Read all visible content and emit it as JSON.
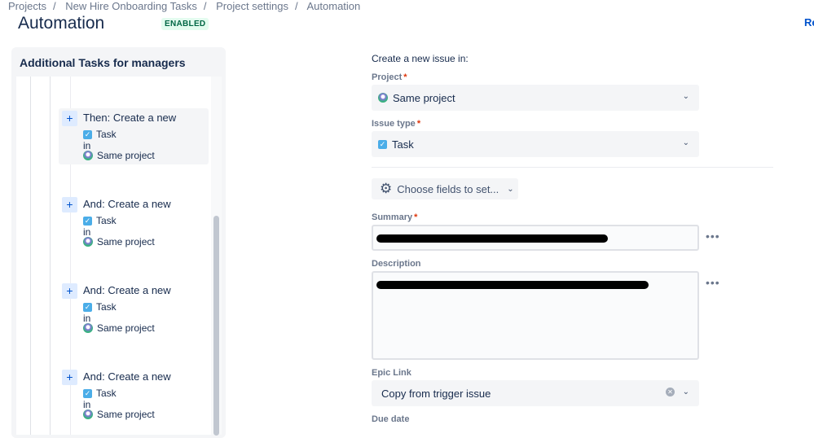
{
  "breadcrumbs": [
    "Projects",
    "New Hire Onboarding Tasks",
    "Project settings",
    "Automation"
  ],
  "header": {
    "title": "Automation",
    "status": "ENABLED",
    "right_link": "Re"
  },
  "rule": {
    "name": "Additional Tasks for managers",
    "steps": [
      {
        "heading": "Then: Create a new",
        "issue_type": "Task",
        "in": "in",
        "project": "Same project"
      },
      {
        "heading": "And: Create a new",
        "issue_type": "Task",
        "in": "in",
        "project": "Same project"
      },
      {
        "heading": "And: Create a new",
        "issue_type": "Task",
        "in": "in",
        "project": "Same project"
      },
      {
        "heading": "And: Create a new",
        "issue_type": "Task",
        "in": "in",
        "project": "Same project"
      }
    ]
  },
  "form": {
    "intro": "Create a new issue in:",
    "project_label": "Project",
    "project_value": "Same project",
    "issue_type_label": "Issue type",
    "issue_type_value": "Task",
    "choose_fields": "Choose fields to set...",
    "summary_label": "Summary",
    "description_label": "Description",
    "epic_label": "Epic Link",
    "epic_value": "Copy from trigger issue",
    "due_label": "Due date",
    "required": "*",
    "more": "•••"
  }
}
